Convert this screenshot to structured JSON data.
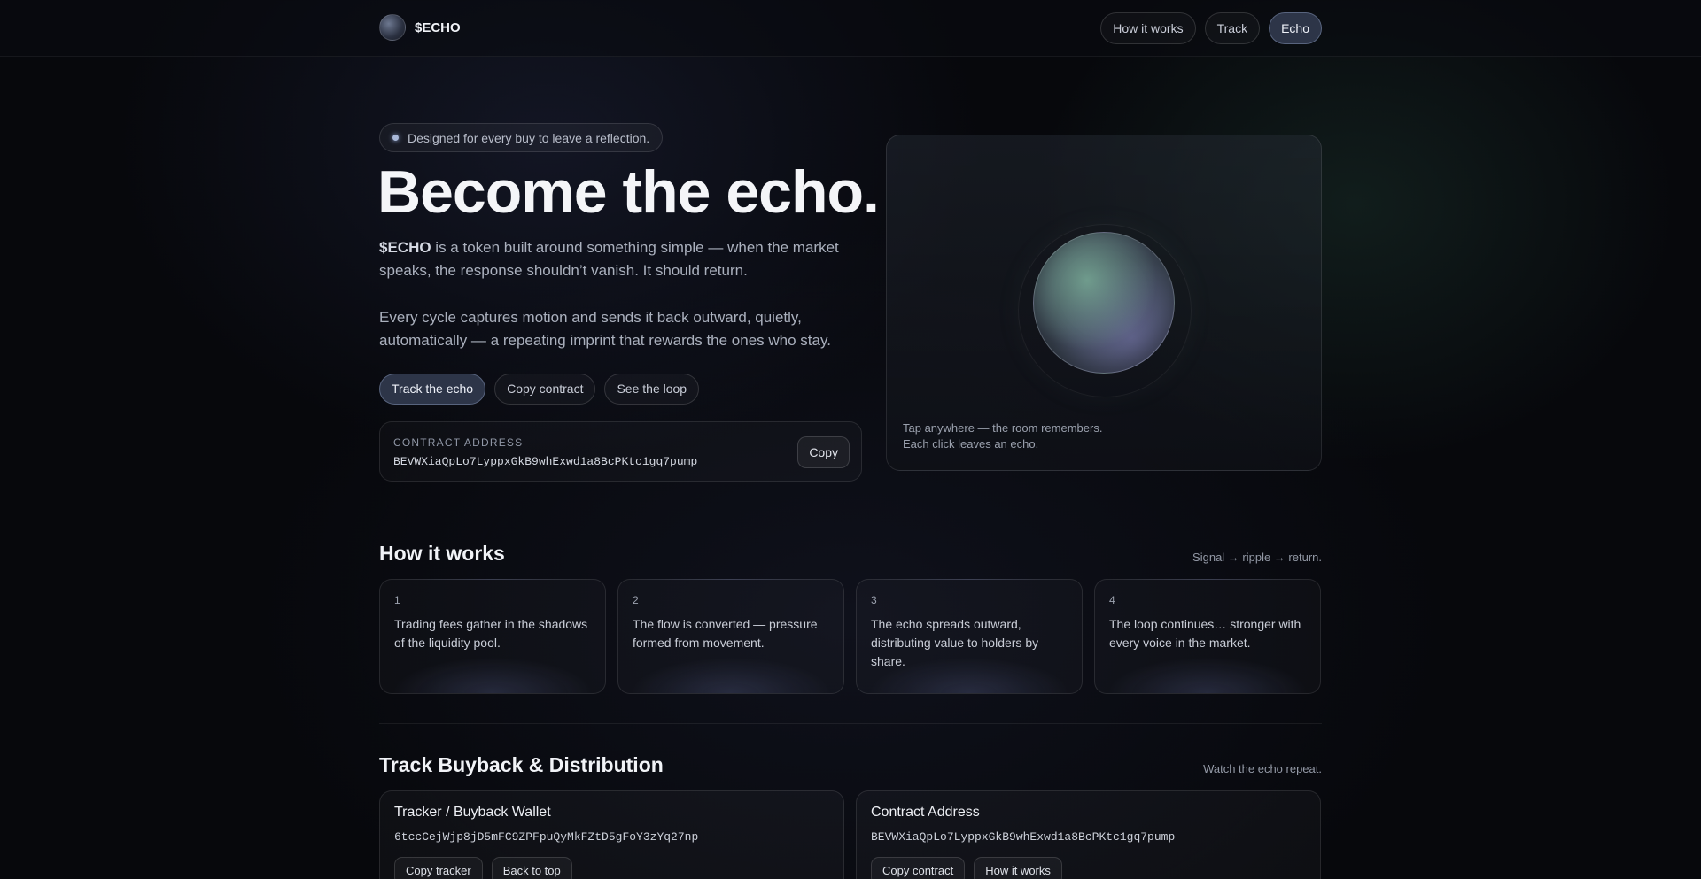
{
  "header": {
    "brand": "$ECHO",
    "nav": [
      {
        "label": "How it works",
        "active": false
      },
      {
        "label": "Track",
        "active": false
      },
      {
        "label": "Echo",
        "active": true
      }
    ]
  },
  "hero": {
    "badge": "Designed for every buy to leave a reflection.",
    "title": "Become the echo.",
    "p1_strong": "$ECHO",
    "p1_rest": " is a token built around something simple — when the market speaks, the response shouldn’t vanish. It should return.",
    "p2": "Every cycle captures motion and sends it back outward, quietly, automatically — a repeating imprint that rewards the ones who stay.",
    "buttons": [
      "Track the echo",
      "Copy contract",
      "See the loop"
    ],
    "contract": {
      "label": "CONTRACT ADDRESS",
      "address": "BEVWXiaQpLo7LyppxGkB9whExwd1a8BcPKtc1gq7pump",
      "copy_label": "Copy"
    }
  },
  "panel": {
    "caption1": "Tap anywhere — the room remembers.",
    "caption2": "Each click leaves an echo."
  },
  "how": {
    "title": "How it works",
    "aside": "Signal → ripple → return.",
    "steps": [
      {
        "num": "1",
        "text": "Trading fees gather in the shadows of the liquidity pool."
      },
      {
        "num": "2",
        "text": "The flow is converted — pressure formed from movement."
      },
      {
        "num": "3",
        "text": "The echo spreads outward, distributing value to holders by share."
      },
      {
        "num": "4",
        "text": "The loop continues… stronger with every voice in the market."
      }
    ]
  },
  "track": {
    "title": "Track Buyback & Distribution",
    "aside": "Watch the echo repeat.",
    "cards": [
      {
        "title": "Tracker / Buyback Wallet",
        "address": "6tccCejWjp8jD5mFC9ZPFpuQyMkFZtD5gFoY3zYq27np",
        "buttons": [
          "Copy tracker",
          "Back to top"
        ]
      },
      {
        "title": "Contract Address",
        "address": "BEVWXiaQpLo7LyppxGkB9whExwd1a8BcPKtc1gq7pump",
        "buttons": [
          "Copy contract",
          "How it works"
        ]
      }
    ]
  }
}
